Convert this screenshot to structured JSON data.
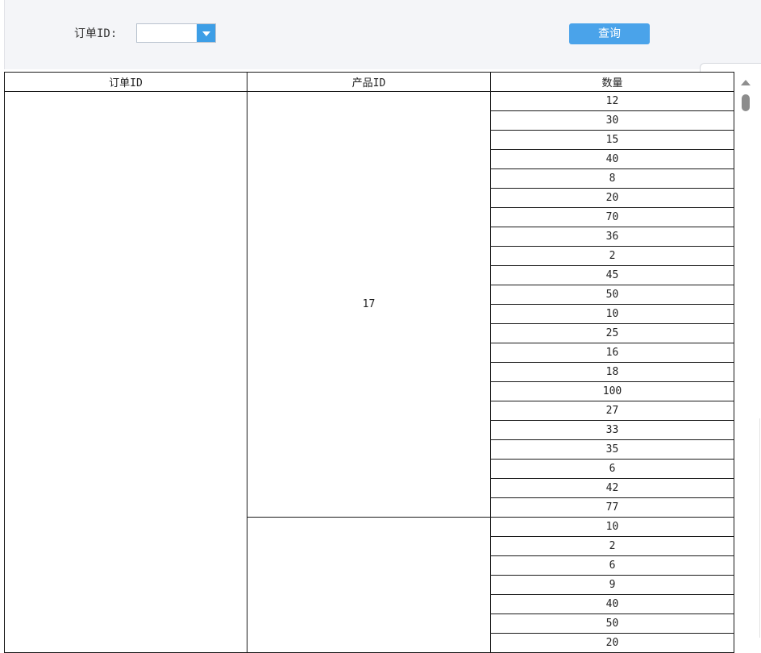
{
  "filter": {
    "label": "订单ID:",
    "order_id_value": "",
    "query_button": "查询"
  },
  "table": {
    "columns": [
      "订单ID",
      "产品ID",
      "数量"
    ],
    "order_id": "",
    "groups": [
      {
        "product_id": "17",
        "quantities": [
          "12",
          "30",
          "15",
          "40",
          "8",
          "20",
          "70",
          "36",
          "2",
          "45",
          "50",
          "10",
          "25",
          "16",
          "18",
          "100",
          "27",
          "33",
          "35",
          "6",
          "42",
          "77"
        ]
      },
      {
        "product_id": "",
        "quantities": [
          "10",
          "2",
          "6",
          "9",
          "40",
          "50",
          "20"
        ]
      }
    ]
  },
  "colors": {
    "accent": "#4aa3ea",
    "combo_arrow": "#3d9ee6",
    "toolbar_bg": "#f4f5f8"
  }
}
